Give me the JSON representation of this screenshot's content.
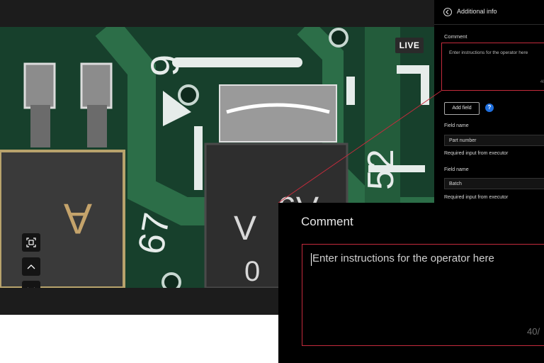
{
  "viewer": {
    "live_badge": "LIVE",
    "silkscreen": [
      "9",
      "A",
      "52",
      "67",
      "A9",
      "V",
      "0"
    ]
  },
  "panel": {
    "title": "Additional info",
    "comment_label": "Comment",
    "comment_placeholder": "Enter instructions for the operator here",
    "comment_counter": "40",
    "add_field_label": "Add field",
    "help_icon": "?",
    "fields": [
      {
        "label": "Field name",
        "value": "Part number",
        "required": "Required input from executor"
      },
      {
        "label": "Field name",
        "value": "Batch",
        "required": "Required input from executor"
      }
    ]
  },
  "zoom": {
    "title": "Comment",
    "placeholder": "Enter instructions for the operator here",
    "counter": "40/"
  },
  "colors": {
    "accent_red": "#c42b3c",
    "help_blue": "#1f6fde",
    "pcb_green": "#17402c"
  }
}
